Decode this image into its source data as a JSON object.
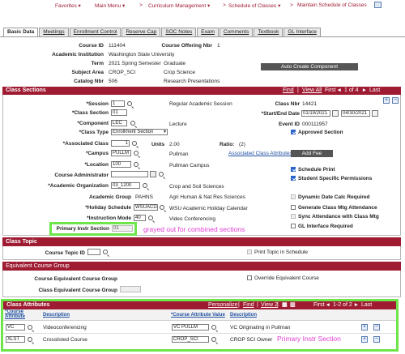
{
  "nav": {
    "favorites": "Favorites",
    "main_menu": "Main Menu",
    "curriculum": "Curriculum Management",
    "schedule": "Schedule of Classes",
    "maintain": "Maintain Schedule of Classes",
    "sep": ">"
  },
  "tabs": [
    "Basic Data",
    "Meetings",
    "Enrollment Control",
    "Reserve Cap",
    "SOC Notes",
    "Exam",
    "Comments",
    "Textbook",
    "GL Interface"
  ],
  "course": {
    "course_id_label": "Course ID",
    "course_id": "111404",
    "offering_label": "Course Offering Nbr",
    "offering": "1",
    "institution_label": "Academic Institution",
    "institution": "Washington State University",
    "term_label": "Term",
    "term": "2021 Spring Semester",
    "term_type": "Graduate",
    "subject_label": "Subject Area",
    "subject": "CROP_SCI",
    "subject_desc": "Crop Science",
    "catalog_label": "Catalog Nbr",
    "catalog": "506",
    "catalog_desc": "Research Presentations",
    "auto_create": "Auto Create Component"
  },
  "sections": {
    "title": "Class Sections",
    "find": "Find",
    "view_all": "View All",
    "first": "First",
    "pager": "1 of 4",
    "last": "Last",
    "session_label": "*Session",
    "session": "1",
    "session_desc": "Regular Academic Session",
    "class_nbr_label": "Class Nbr",
    "class_nbr": "14421",
    "class_section_label": "*Class Section",
    "class_section": "01",
    "dates_label": "*Start/End Date",
    "start_date": "01/19/2021",
    "end_date": "04/30/2021",
    "component_label": "*Component",
    "component": "LEC",
    "component_desc": "Lecture",
    "event_id_label": "Event ID",
    "event_id": "000111957",
    "class_type_label": "*Class Type",
    "class_type": "Enrollment Section",
    "approved_section": "Approved Section",
    "assoc_class_label": "*Associated Class",
    "assoc_class": "1",
    "units_label": "Units",
    "units": "2.00",
    "ratio_label": "Ratio:",
    "ratio": "(2)",
    "campus_label": "*Campus",
    "campus": "PULLM",
    "campus_desc": "Pullman",
    "assoc_attr_link": "Associated Class Attributes",
    "add_fee": "Add Fee",
    "location_label": "*Location",
    "location": "100",
    "location_desc": "Pullman Campus",
    "schedule_print": "Schedule Print",
    "admin_label": "Course Administrator",
    "student_perms": "Student Specific Permissions",
    "acad_org_label": "*Academic Organization",
    "acad_org": "03_1200",
    "acad_org_desc": "Crop and Soil Sciences",
    "acad_group_label": "Academic Group",
    "acad_group": "PAHNS",
    "acad_group_desc": "Agri Human & Nat Res Sciences",
    "dynamic_date": "Dynamic Date Calc Required",
    "holiday_label": "*Holiday Schedule",
    "holiday": "WSUACD",
    "holiday_desc": "WSU Academic Holiday Calendar",
    "gen_mtg": "Generate Class Mtg Attendance",
    "instr_mode_label": "*Instruction Mode",
    "instr_mode": "40",
    "instr_mode_desc": "Video Conferencing",
    "sync_attend": "Sync Attendance with Class Mtg",
    "primary_label": "Primary Instr Section",
    "primary": "01",
    "gl_interface": "GL Interface Required",
    "annotation": "grayed out for combined sections"
  },
  "topic": {
    "title": "Class Topic",
    "topic_label": "Course Topic ID",
    "print_topic": "Print Topic in Schedule"
  },
  "equiv": {
    "title": "Equivalent Course Group",
    "group_label": "Course Equivalent Course Group",
    "override": "Override Equivalent Course",
    "class_group_label": "Class Equivalent Course Group"
  },
  "attributes": {
    "title": "Class Attributes",
    "personalize": "Personalize",
    "find": "Find",
    "view": "View 2",
    "first": "First",
    "pager": "1-2 of 2",
    "last": "Last",
    "headers": [
      "*Course Attribute",
      "Description",
      "*Course Attribute Value",
      "Description"
    ],
    "rows": [
      {
        "attr": "VC",
        "desc": "Videoconferencing",
        "value": "VC PULLM",
        "value_desc": "VC Originating in Pullman"
      },
      {
        "attr": "XLST",
        "desc": "Crosslisted Course",
        "value": "CROP_SCI",
        "value_desc": "CROP SCI Owner"
      }
    ],
    "annotation": "Primary Instr Section"
  }
}
